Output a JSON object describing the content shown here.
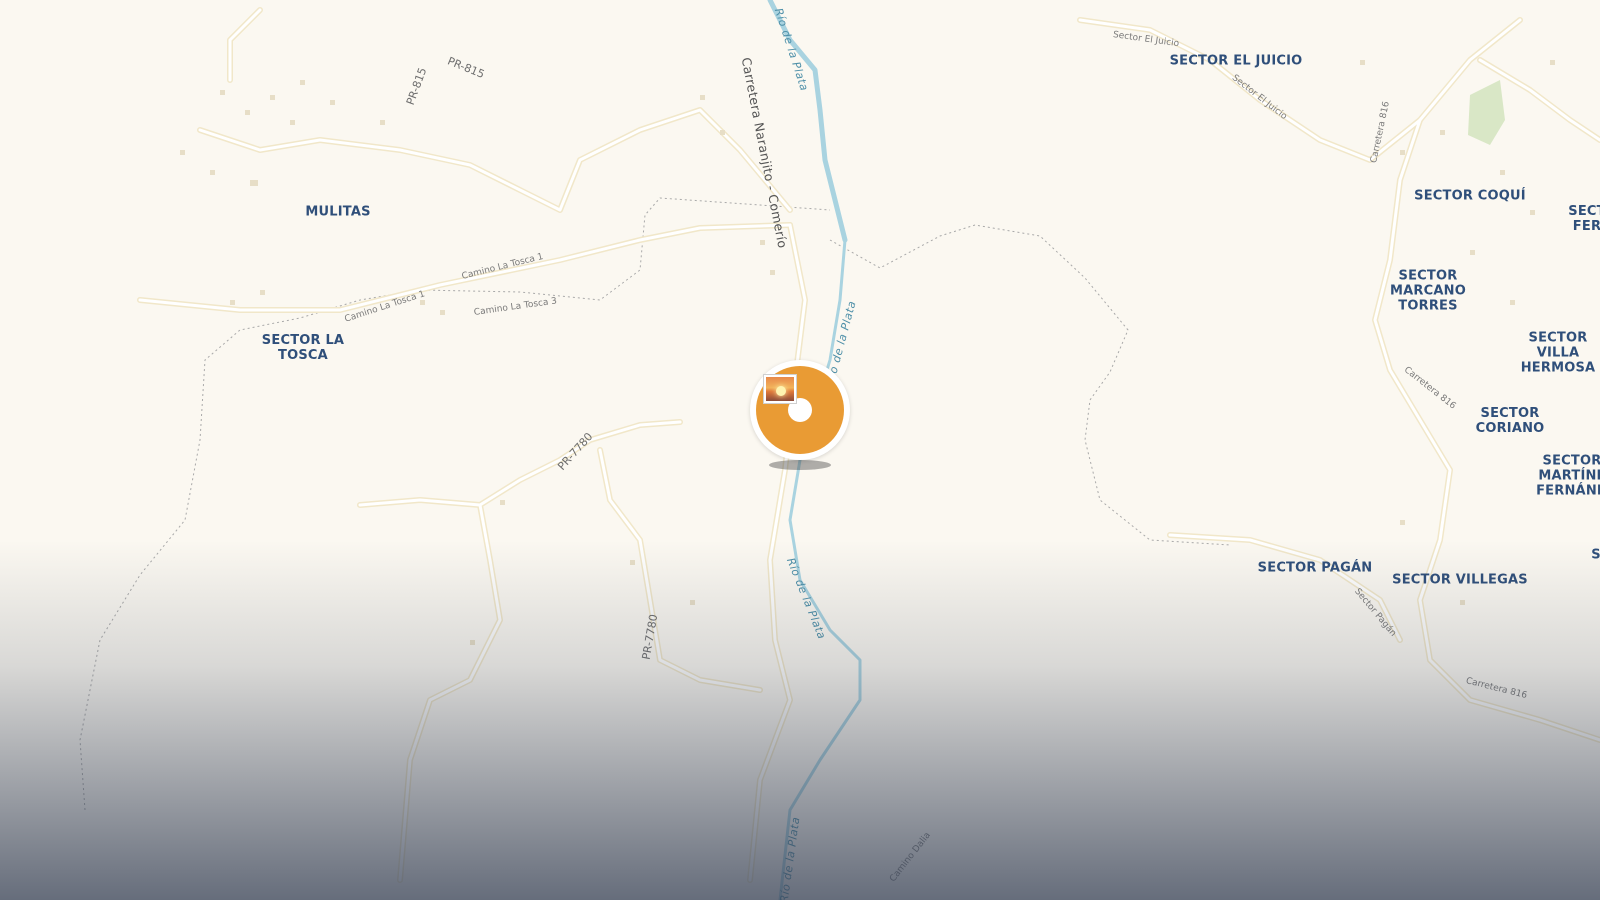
{
  "map": {
    "place_labels": [
      {
        "id": "mulitas",
        "text": "MULITAS"
      },
      {
        "id": "sector-la-tosca",
        "text": "SECTOR LA\nTOSCA"
      },
      {
        "id": "sector-el-juicio",
        "text": "SECTOR EL JUICIO"
      },
      {
        "id": "sector-coqui",
        "text": "SECTOR COQUÍ"
      },
      {
        "id": "sector-fer",
        "text": "SECT\nFER"
      },
      {
        "id": "sector-marcano-torres",
        "text": "SECTOR\nMARCANO\nTORRES"
      },
      {
        "id": "sector-villa-hermosa",
        "text": "SECTOR VILLA\nHERMOSA"
      },
      {
        "id": "sector-coriano",
        "text": "SECTOR CORIANO"
      },
      {
        "id": "sector-martinez-fernandez",
        "text": "SECTOR\nMARTÍNE\nFERNÁND"
      },
      {
        "id": "sector-pagan",
        "text": "SECTOR PAGÁN"
      },
      {
        "id": "sector-villegas",
        "text": "SECTOR VILLEGAS"
      },
      {
        "id": "sector-edge",
        "text": "S"
      }
    ],
    "road_labels": [
      {
        "id": "pr-815-a",
        "text": "PR-815"
      },
      {
        "id": "pr-815-b",
        "text": "PR-815"
      },
      {
        "id": "carretera-naranjito-comerio",
        "text": "Carretera Naranjito - Comerío"
      },
      {
        "id": "camino-la-tosca-1-a",
        "text": "Camino La Tosca 1"
      },
      {
        "id": "camino-la-tosca-1-b",
        "text": "Camino La Tosca 1"
      },
      {
        "id": "camino-la-tosca-3",
        "text": "Camino La Tosca 3"
      },
      {
        "id": "pr-7780-a",
        "text": "PR-7780"
      },
      {
        "id": "pr-7780-b",
        "text": "PR-7780"
      },
      {
        "id": "sector-el-juicio-road-a",
        "text": "Sector El Juicio"
      },
      {
        "id": "sector-el-juicio-road-b",
        "text": "Sector El Juicio"
      },
      {
        "id": "carretera-816-a",
        "text": "Carretera 816"
      },
      {
        "id": "carretera-816-b",
        "text": "Carretera 816"
      },
      {
        "id": "carretera-816-c",
        "text": "Carretera 816"
      },
      {
        "id": "sector-pagan-road",
        "text": "Sector Pagán"
      },
      {
        "id": "camino-dalia",
        "text": "Camino Dalia"
      }
    ],
    "river_labels": [
      {
        "id": "rio-top",
        "text": "Río de la Plata"
      },
      {
        "id": "rio-mid",
        "text": "Río de la Plata"
      },
      {
        "id": "rio-lower",
        "text": "Río de la Plata"
      },
      {
        "id": "rio-bottom",
        "text": "Río de la Plata"
      }
    ],
    "marker": {
      "icon": "photo-sunset-icon",
      "color": "#e99b34"
    },
    "colors": {
      "land": "#fbf8f1",
      "road": "#ffffff",
      "road_casing": "#efe6cf",
      "river": "#a9d3e0",
      "place_label": "#2f4f7a",
      "park": "#d8e6c4"
    }
  }
}
